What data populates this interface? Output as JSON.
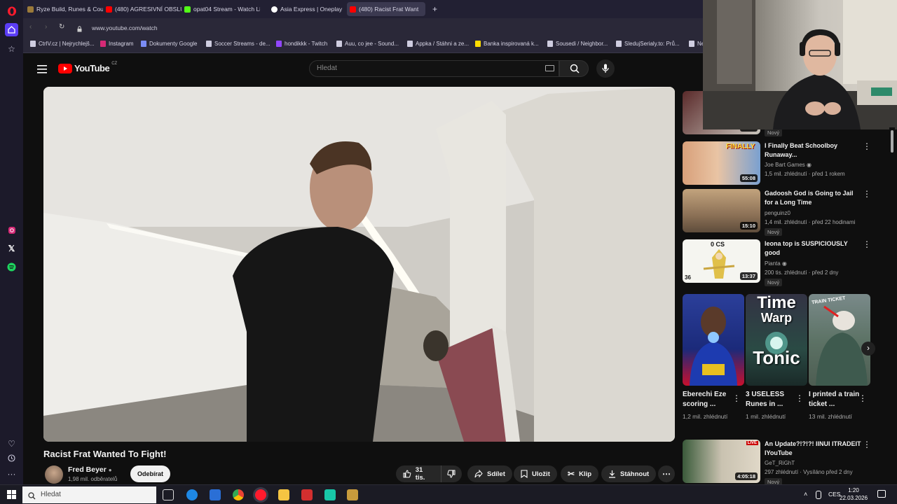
{
  "tabs": [
    {
      "label": "Ryze Build, Runes & Coun",
      "color": "#9b7a3a"
    },
    {
      "label": "(480) AGRESIVNÍ OBSLUH",
      "color": "#ff0000"
    },
    {
      "label": "opat04 Stream - Watch Li",
      "color": "#53fc18"
    },
    {
      "label": "Asia Express | Oneplay",
      "color": "#ffffff"
    },
    {
      "label": "(480) Racist Frat Want",
      "color": "#ff0000"
    }
  ],
  "url": "www.youtube.com/watch",
  "bookmarks": [
    "CtrlV.cz | Nejrychlejš...",
    "Instagram",
    "Dokumenty Google",
    "Soccer Streams - de...",
    "hondikkk - Twitch",
    "Auu, co jee - Sound...",
    "Appka / Stáhni a ze...",
    "Banka inspirovaná k...",
    "Sousedi / Neighbor...",
    "SledujSerialy.to: Prů...",
    "Ne"
  ],
  "youtube": {
    "logo": "YouTube",
    "region": "CZ",
    "search_placeholder": "Hledat"
  },
  "video": {
    "title": "Racist Frat Wanted To Fight!",
    "channel": "Fred Beyer",
    "subscribers": "1,98 mil. odběratelů",
    "subscribe_label": "Odebírat",
    "likes": "31 tis.",
    "share_label": "Sdílet",
    "save_label": "Uložit",
    "clip_label": "Klip",
    "download_label": "Stáhnout"
  },
  "recommendations": [
    {
      "title": "",
      "channel": "",
      "meta": "",
      "badge": "Nový",
      "duration": "16:15"
    },
    {
      "title": "I Finally Beat Schoolboy Runaway...",
      "channel": "Joe Bart Games",
      "meta": "1,5 mil. zhlédnutí · před 1 rokem",
      "badge": "",
      "duration": "55:08"
    },
    {
      "title": "Gadoosh God is Going to Jail for a Long Time",
      "channel": "penguinz0",
      "meta": "1,4 mil. zhlédnutí · před 22 hodinami",
      "badge": "Nový",
      "duration": "15:10"
    },
    {
      "title": "leona top is SUSPICIOUSLY good",
      "channel": "Pianta",
      "meta": "200 tis. zhlédnutí · před 2 dny",
      "badge": "Nový",
      "duration": "13:37"
    },
    {
      "title": "An Update?!?!?! IINUI ITRADEIT IYouTube",
      "channel": "GeT_RiGhT",
      "meta": "297 zhlédnutí · Vysíláno před 2 dny",
      "badge": "Nový",
      "duration": "4:05:18"
    }
  ],
  "thumb_text": {
    "finally": "FINALLY",
    "ocs": "0 CS",
    "level": "36",
    "live": "LIVE"
  },
  "shorts": [
    {
      "title": "Eberechi Eze scoring ...",
      "views": "1,2 mil. zhlédnutí"
    },
    {
      "title": "3 USELESS Runes in ...",
      "views": "1 mil. zhlédnutí",
      "overlay_top": "Time",
      "overlay_mid": "Warp",
      "overlay_bottom": "Tonic"
    },
    {
      "title": "I printed a train ticket ...",
      "views": "13 mil. zhlédnutí",
      "overlay_top": "TRAIN TICKET"
    }
  ],
  "taskbar": {
    "search_placeholder": "Hledat",
    "language": "CES",
    "time": "1:20",
    "date": "22.03.2026"
  },
  "colors": {
    "youtube_red": "#ff0000",
    "background": "#0f0f0f",
    "opera_red": "#ff1b2d"
  }
}
